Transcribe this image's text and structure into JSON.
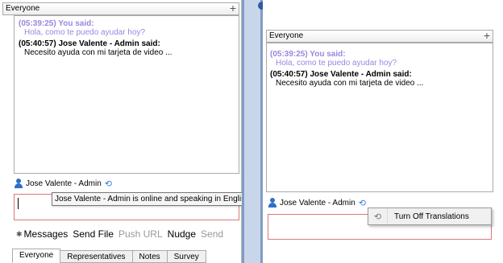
{
  "left": {
    "channel": "Everyone",
    "messages": [
      {
        "header": "(05:39:25) You said:",
        "text": "Hola, como te puedo ayudar hoy?"
      },
      {
        "header": "(05:40:57) Jose Valente - Admin said:",
        "text": "Necesito ayuda con mi tarjeta de video ..."
      }
    ],
    "status_name": "Jose Valente - Admin",
    "tooltip": "Jose Valente - Admin is online and speaking in English",
    "actions": {
      "messages": "Messages",
      "send_file": "Send File",
      "push_url": "Push URL",
      "nudge": "Nudge",
      "send": "Send"
    },
    "tabs": [
      "Everyone",
      "Representatives",
      "Notes",
      "Survey"
    ]
  },
  "right": {
    "channel": "Everyone",
    "messages": [
      {
        "header": "(05:39:25) You said:",
        "text": "Hola, como te puedo ayudar hoy?"
      },
      {
        "header": "(05:40:57) Jose Valente - Admin said:",
        "text": "Necesito ayuda con mi tarjeta de video ..."
      }
    ],
    "status_name": "Jose Valente - Admin",
    "menu_item": "Turn Off Translations"
  },
  "icons": {
    "plus": "plus-icon",
    "person": "person-icon",
    "translate": "translate-icon",
    "star": "star-icon"
  },
  "colors": {
    "you_said": "#9b86e0",
    "input_border": "#d77",
    "divider": "#7f9cc4"
  }
}
